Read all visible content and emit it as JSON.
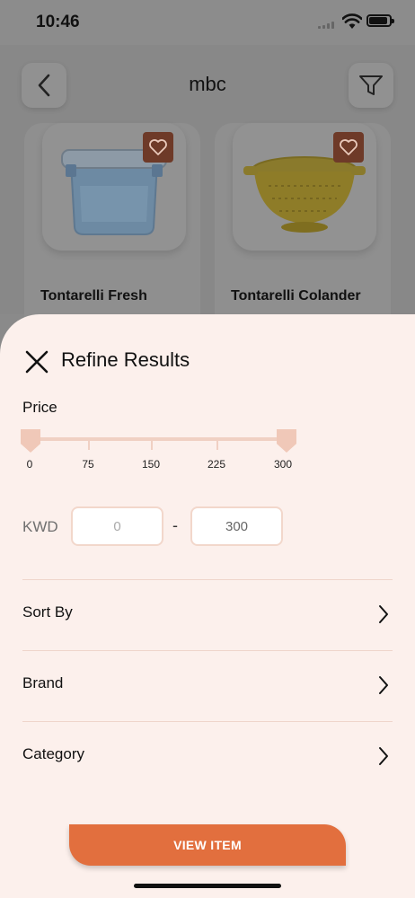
{
  "status_bar": {
    "time": "10:46"
  },
  "header": {
    "title": "mbc"
  },
  "products": [
    {
      "name": "Tontarelli Fresh"
    },
    {
      "name": "Tontarelli Colander"
    }
  ],
  "sheet": {
    "title": "Refine Results",
    "price_label": "Price",
    "range": {
      "min": 0,
      "max": 300,
      "selected_min": 0,
      "selected_max": 300
    },
    "ticks": [
      "0",
      "75",
      "150",
      "225",
      "300"
    ],
    "currency": "KWD",
    "min_placeholder": "0",
    "max_placeholder": "300",
    "separator": "-",
    "options": [
      {
        "label": "Sort By"
      },
      {
        "label": "Brand"
      },
      {
        "label": "Category"
      }
    ],
    "cta_label": "VIEW ITEM"
  },
  "colors": {
    "accent": "#e26f3e",
    "sheet_background": "#fcf0ec",
    "slider": "#f0d0c3"
  }
}
